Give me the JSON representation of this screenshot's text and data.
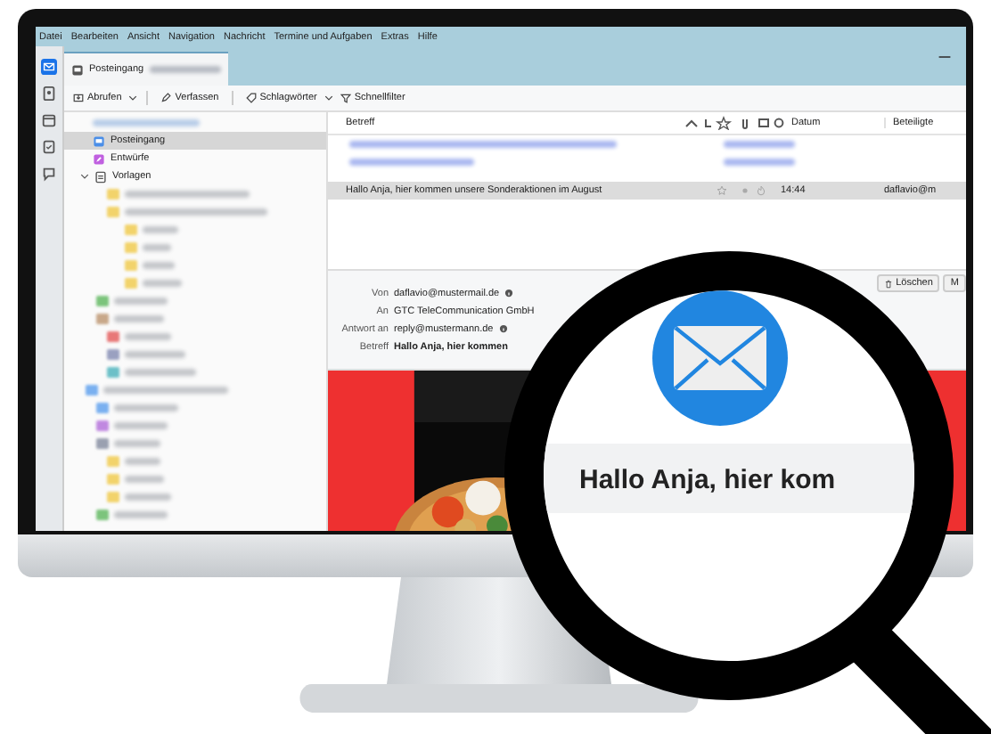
{
  "menu_bar": [
    "Datei",
    "Bearbeiten",
    "Ansicht",
    "Navigation",
    "Nachricht",
    "Termine und Aufgaben",
    "Extras",
    "Hilfe"
  ],
  "tab": {
    "label": "Posteingang"
  },
  "toolbar": [
    {
      "label": "Abrufen",
      "kind": "fetch"
    },
    {
      "label": "Verfassen",
      "kind": "compose"
    },
    {
      "label": "Schlagwörter",
      "kind": "tags"
    },
    {
      "label": "Schnellfilter",
      "kind": "filter"
    }
  ],
  "folders": [
    {
      "label": "Posteingang",
      "kind": "inbox",
      "selected": true
    },
    {
      "label": "Entwürfe",
      "kind": "drafts",
      "selected": false
    },
    {
      "label": "Vorlagen",
      "kind": "templates",
      "selected": false
    }
  ],
  "message_list": {
    "columns": [
      "Betreff",
      "Datum",
      "Beteiligte"
    ],
    "rows": [
      {
        "subject": "Hallo Anja, hier kommen unsere Sonderaktionen im August",
        "date": "14:44",
        "correspondent": "daflavio@m",
        "selected": true
      }
    ]
  },
  "headers": [
    {
      "label": "Von",
      "value": "daflavio@mustermail.de"
    },
    {
      "label": "An",
      "value": "GTC TeleCommunication GmbH"
    },
    {
      "label": "Antwort an",
      "value": "reply@mustermann.de"
    },
    {
      "label": "Betreff",
      "value": "Hallo Anja, hier kommen"
    }
  ],
  "actions": [
    "Löschen",
    "M"
  ],
  "magnifier": {
    "text": "Hallo Anja, hier kom"
  }
}
